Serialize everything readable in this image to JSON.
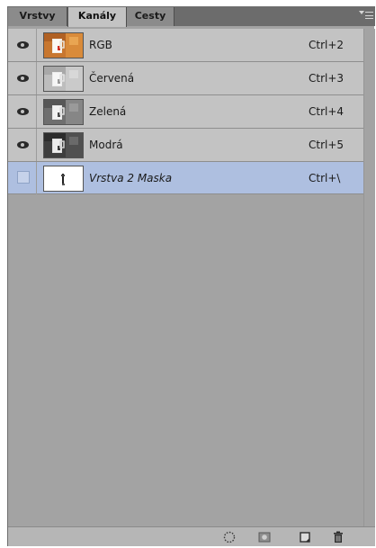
{
  "panel": {
    "tabs": [
      {
        "label": "Vrstvy",
        "active": false
      },
      {
        "label": "Kanály",
        "active": true
      },
      {
        "label": "Cesty",
        "active": false
      }
    ]
  },
  "channels": [
    {
      "name": "RGB",
      "shortcut": "Ctrl+2",
      "visible": true,
      "thumbnail": "color-image"
    },
    {
      "name": "Červená",
      "shortcut": "Ctrl+3",
      "visible": true,
      "thumbnail": "grayscale-light"
    },
    {
      "name": "Zelená",
      "shortcut": "Ctrl+4",
      "visible": true,
      "thumbnail": "grayscale-medium"
    },
    {
      "name": "Modrá",
      "shortcut": "Ctrl+5",
      "visible": true,
      "thumbnail": "grayscale-dark"
    },
    {
      "name": "Vrstva 2 Maska",
      "shortcut": "Ctrl+\\",
      "visible": false,
      "selected": true,
      "thumbnail": "mask"
    }
  ],
  "toolbar": {
    "icons": [
      "load-selection-icon",
      "save-selection-icon",
      "new-channel-icon",
      "trash-icon"
    ]
  },
  "colors": {
    "panel_bg": "#a3a3a3",
    "row_bg": "#c3c3c3",
    "selected_row": "#aebfe0",
    "tab_bar": "#6f6f6f"
  }
}
